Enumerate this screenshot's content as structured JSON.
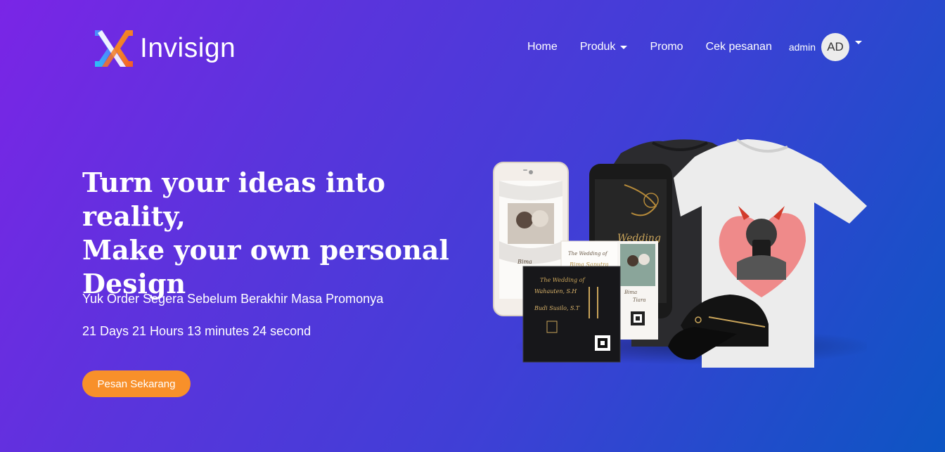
{
  "brand": {
    "name": "Invisign"
  },
  "nav": {
    "home": "Home",
    "produk": "Produk",
    "promo": "Promo",
    "cek_pesanan": "Cek pesanan",
    "user_name": "admin",
    "avatar_initials": "AD"
  },
  "hero": {
    "title_lines": [
      "Turn your ideas into reality,",
      "Make your own personal",
      "Design"
    ],
    "subtitle": "Yuk Order Segera Sebelum Berakhir Masa Promonya",
    "countdown": "21 Days 21 Hours 13 minutes 24 second",
    "cta_label": "Pesan Sekarang"
  },
  "mockup": {
    "card_names": [
      "Bima Saputra",
      "Bima",
      "Tiara"
    ],
    "card_heading": "The Wedding of",
    "card_names_dark": [
      "Wahauten, S.H",
      "Budi Susilo, S.T"
    ]
  },
  "colors": {
    "cta": "#f8902a",
    "avatar_bg": "#ececec",
    "bg_start": "#7a25e6",
    "bg_end": "#0d55c3"
  }
}
